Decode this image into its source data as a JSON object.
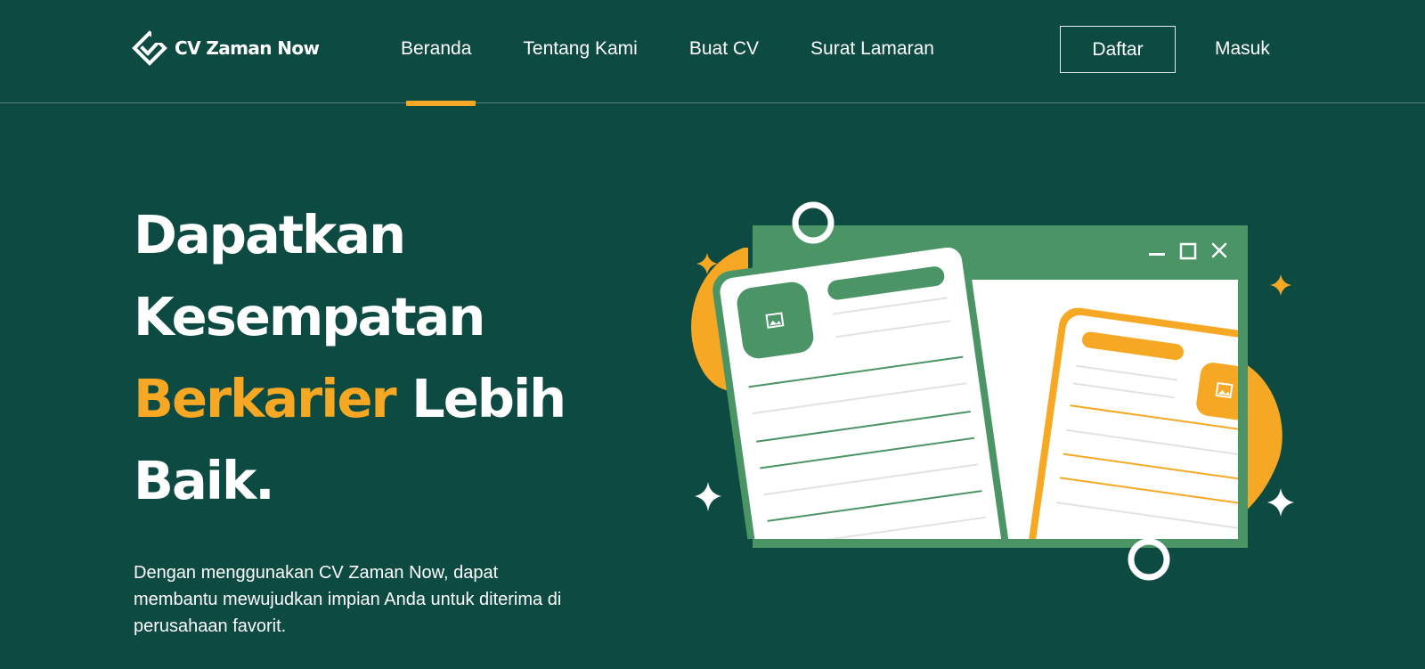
{
  "brand": {
    "name": "CV Zaman Now",
    "icon": "diamond-check-logo-icon"
  },
  "nav": {
    "items": [
      {
        "label": "Beranda",
        "active": true
      },
      {
        "label": "Tentang Kami",
        "active": false
      },
      {
        "label": "Buat CV",
        "active": false
      },
      {
        "label": "Surat Lamaran",
        "active": false
      }
    ],
    "register_label": "Daftar",
    "login_label": "Masuk"
  },
  "hero": {
    "title_line1": "Dapatkan",
    "title_line2": "Kesempatan",
    "title_accent": "Berkarier",
    "title_line3_rest": " Lebih",
    "title_line4": "Baik.",
    "description": "Dengan menggunakan CV Zaman Now, dapat membantu mewujudkan impian Anda untuk diterima di perusahaan favorit."
  },
  "illustration": {
    "icons": [
      "minimize-icon",
      "maximize-icon",
      "close-icon",
      "image-placeholder-icon",
      "sparkle-icon",
      "circle-icon"
    ]
  },
  "colors": {
    "background": "#0d4a41",
    "accent": "#f6a824",
    "green_window": "#4a9466",
    "text": "#ffffff"
  }
}
